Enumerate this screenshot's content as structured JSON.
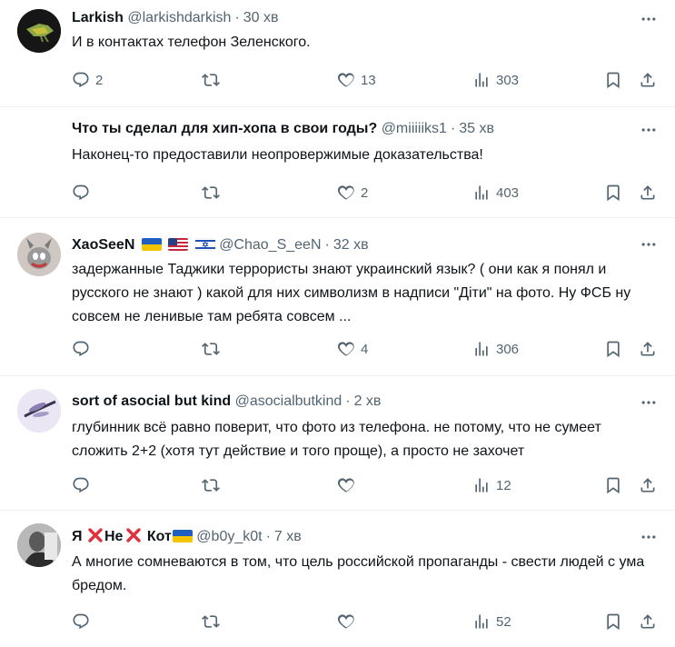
{
  "tweets": [
    {
      "name": "Larkish",
      "handle": "@larkishdarkish",
      "time": "30 хв",
      "text": "И в контактах телефон Зеленского.",
      "replies": "2",
      "retweets": "",
      "likes": "13",
      "views": "303"
    },
    {
      "name": "Что ты сделал для хип-хопа в свои годы?",
      "handle": "@miiiiiks1",
      "time": "35 хв",
      "text": "Наконец-то предоставили неопровержимые доказательства!",
      "replies": "",
      "retweets": "",
      "likes": "2",
      "views": "403"
    },
    {
      "name": "XaoSeeN",
      "handle": "@Chao_S_eeN",
      "time": "32 хв",
      "text": "задержанные Таджики террористы знают украинский язык? ( они как я понял и русского не знают ) какой для них символизм в надписи \"Діти\" на фото. Ну ФСБ ну совсем не ленивые там ребята совсем ...",
      "replies": "",
      "retweets": "",
      "likes": "4",
      "views": "306",
      "flags": [
        "ukraine-flag",
        "usa-flag",
        "israel-flag"
      ]
    },
    {
      "name": "sort of asocial but kind",
      "handle": "@asocialbutkind",
      "time": "2 хв",
      "text": "глубинник всё равно поверит, что фото из телефона. не потому, что не сумеет сложить 2+2 (хотя тут действие и того проще), а просто не захочет",
      "replies": "",
      "retweets": "",
      "likes": "",
      "views": "12"
    },
    {
      "name_parts": [
        "Я",
        "Не",
        "Кот"
      ],
      "handle": "@b0y_k0t",
      "time": "7 хв",
      "text": "А многие сомневаются в том, что цель российской пропаганды - свести людей с ума бредом.",
      "replies": "",
      "retweets": "",
      "likes": "",
      "views": "52",
      "flags": [
        "ukraine-flag"
      ]
    }
  ],
  "colors": {
    "text": "#0f1419",
    "secondary": "#536471",
    "divider": "#eff3f4",
    "red_cross": "#e0323a"
  }
}
